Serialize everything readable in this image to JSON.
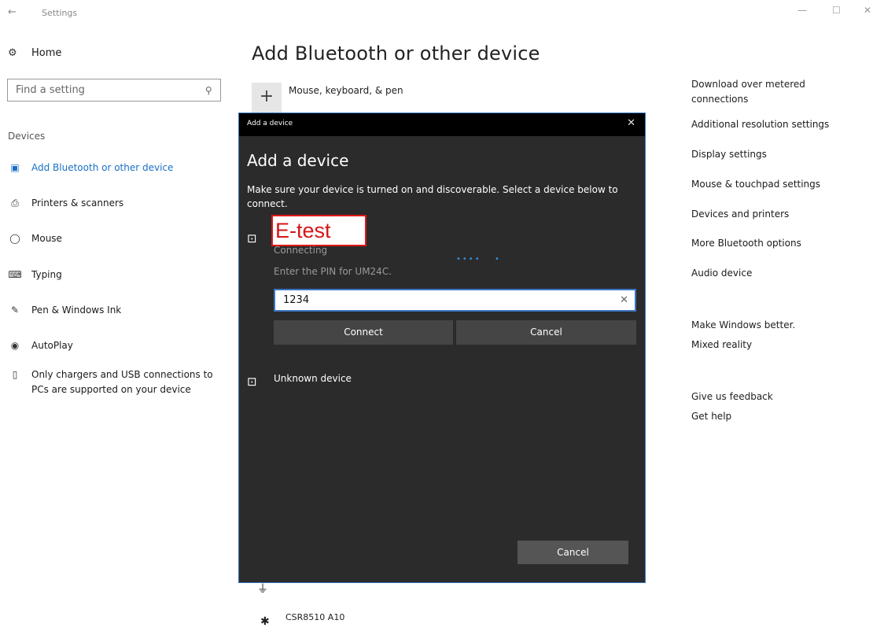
{
  "window": {
    "back": "←",
    "title": "Settings",
    "minimize": "—",
    "maximize": "☐",
    "close": "✕"
  },
  "sidebar": {
    "home": "Home",
    "search_placeholder": "Find a setting",
    "section": "Devices",
    "items": [
      {
        "label": "Add Bluetooth or other device",
        "icon": "bluetooth-devices-icon",
        "active": true
      },
      {
        "label": "Printers & scanners",
        "icon": "printer-icon",
        "active": false
      },
      {
        "label": "Mouse",
        "icon": "mouse-icon",
        "active": false
      },
      {
        "label": "Typing",
        "icon": "keyboard-icon",
        "active": false
      },
      {
        "label": "Pen & Windows Ink",
        "icon": "pen-icon",
        "active": false
      },
      {
        "label": "AutoPlay",
        "icon": "autoplay-icon",
        "active": false
      },
      {
        "label": "Only chargers and USB connections to PCs are supported on your device",
        "icon": "usb-icon",
        "active": false
      }
    ]
  },
  "main": {
    "title": "Add Bluetooth or other device",
    "add_label": "Mouse, keyboard, & pen",
    "bottom_device": "CSR8510 A10"
  },
  "right": {
    "metered": "Download over metered connections",
    "links1": [
      "Additional resolution settings",
      "Display settings",
      "Mouse & touchpad settings",
      "Devices and printers",
      "More Bluetooth options",
      "Audio device"
    ],
    "make_better": "Make Windows better.",
    "mixed_reality": "Mixed reality",
    "feedback": "Give us feedback",
    "get_help": "Get help"
  },
  "dialog": {
    "bar_title": "Add a device",
    "close": "✕",
    "heading": "Add a device",
    "description": "Make sure your device is turned on and discoverable. Select a device below to connect.",
    "device_name": "E-test",
    "status": "Connecting",
    "pin_prompt": "Enter the PIN for UM24C.",
    "pin_value": "1234",
    "connect": "Connect",
    "cancel_inline": "Cancel",
    "unknown_device": "Unknown device",
    "cancel": "Cancel"
  },
  "colors": {
    "accent": "#1a6fc4",
    "dialog_bg": "#2b2b2b",
    "highlight_border": "#e01818"
  }
}
